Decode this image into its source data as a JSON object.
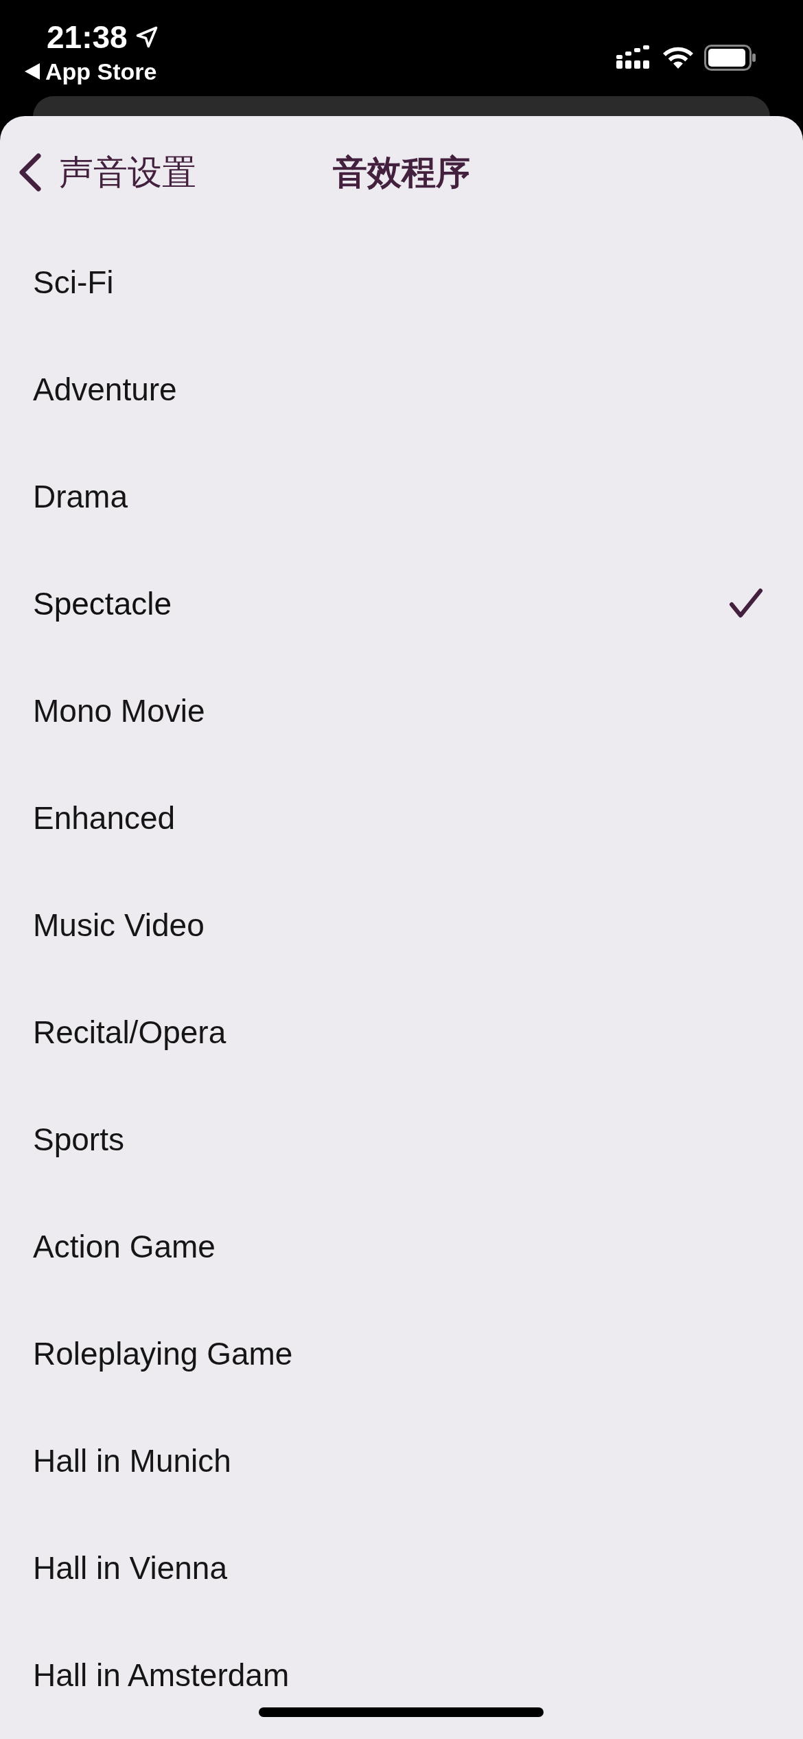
{
  "status_bar": {
    "time": "21:38",
    "back_app": "App Store"
  },
  "nav": {
    "back_label": "声音设置",
    "title": "音效程序"
  },
  "items": [
    {
      "label": "Sci-Fi",
      "selected": false
    },
    {
      "label": "Adventure",
      "selected": false
    },
    {
      "label": "Drama",
      "selected": false
    },
    {
      "label": "Spectacle",
      "selected": true
    },
    {
      "label": "Mono Movie",
      "selected": false
    },
    {
      "label": "Enhanced",
      "selected": false
    },
    {
      "label": "Music Video",
      "selected": false
    },
    {
      "label": "Recital/Opera",
      "selected": false
    },
    {
      "label": "Sports",
      "selected": false
    },
    {
      "label": "Action Game",
      "selected": false
    },
    {
      "label": "Roleplaying Game",
      "selected": false
    },
    {
      "label": "Hall in Munich",
      "selected": false
    },
    {
      "label": "Hall in Vienna",
      "selected": false
    },
    {
      "label": "Hall in Amsterdam",
      "selected": false
    }
  ]
}
